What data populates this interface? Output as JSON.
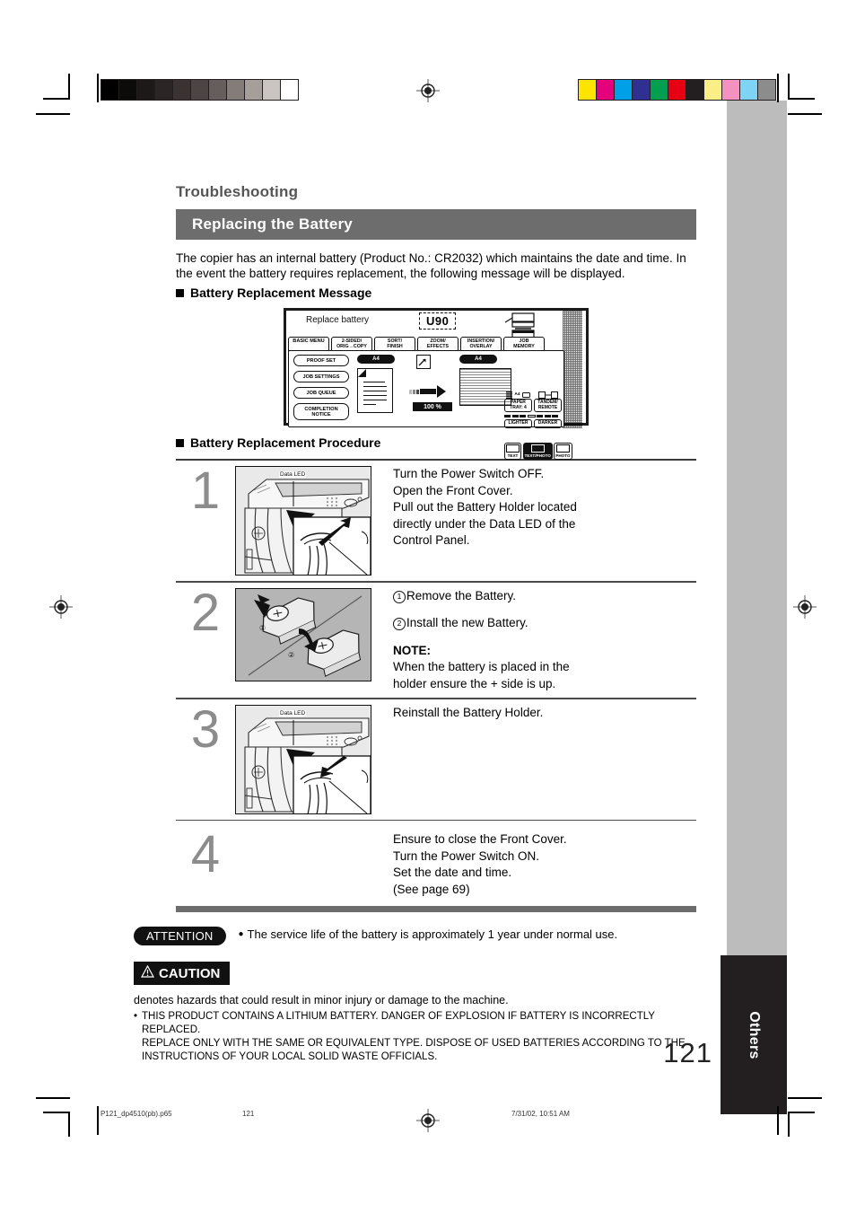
{
  "document": {
    "section_title": "Troubleshooting",
    "banner_title": "Replacing the Battery",
    "intro": "The copier has an internal battery (Product No.: CR2032) which maintains the date and time. In the event the battery requires replacement, the following message will be displayed.",
    "subheads": {
      "message": "Battery Replacement Message",
      "procedure": "Battery Replacement Procedure"
    },
    "page_number": "121",
    "side_tab": "Others"
  },
  "lcd": {
    "message": "Replace battery",
    "code": "U90",
    "tabs": [
      {
        "label": "BASIC MENU",
        "selected": true
      },
      {
        "label": "2-SIDED/\nORIG→COPY",
        "selected": false
      },
      {
        "label": "SORT/\nFINISH",
        "selected": false
      },
      {
        "label": "ZOOM/\nEFFECTS",
        "selected": false
      },
      {
        "label": "INSERTION/\nOVERLAY",
        "selected": false
      },
      {
        "label": "JOB\nMEMORY",
        "selected": false
      }
    ],
    "left_buttons": [
      "PROOF SET",
      "JOB SETTINGS",
      "JOB QUEUE",
      "COMPLETION\nNOTICE"
    ],
    "original_size": "A4",
    "output_size": "A4",
    "zoom_ratio": "100 %",
    "paper_tray": "PAPER TRAY: 4",
    "paper_tray_size": "A4",
    "tandem_remote": "TANDEM/\nREMOTE",
    "lighter": "LIGHTER",
    "darker": "DARKER",
    "modes": [
      {
        "label": "TEXT",
        "selected": false
      },
      {
        "label": "TEXT/PHOTO",
        "selected": true
      },
      {
        "label": "PHOTO",
        "selected": false
      }
    ]
  },
  "steps": [
    {
      "number": "1",
      "figure": "machine-front-cover-battery-holder",
      "figure_label": "Data LED",
      "lines": [
        "Turn the Power Switch OFF.",
        "Open the Front Cover.",
        "Pull out the Battery Holder located",
        "directly under the Data LED of the",
        "Control Panel."
      ]
    },
    {
      "number": "2",
      "figure": "battery-holder-remove-install",
      "figure_label": "",
      "callout_1": "1",
      "callout_2": "2",
      "item1": "Remove the Battery.",
      "item2": "Install the new Battery.",
      "note_label": "NOTE",
      "note_lines": [
        "When the battery is placed in the",
        "holder ensure the + side is up."
      ]
    },
    {
      "number": "3",
      "figure": "machine-reinstall-battery-holder",
      "figure_label": "Data LED",
      "lines": [
        "Reinstall the Battery Holder."
      ]
    },
    {
      "number": "4",
      "figure": "",
      "figure_label": "",
      "lines": [
        "Ensure to close the Front Cover.",
        "Turn the Power Switch ON.",
        "Set the date and time.",
        "(See page 69)"
      ]
    }
  ],
  "attention": {
    "badge": "ATTENTION",
    "text": "The service life of the battery is approximately 1 year under normal use."
  },
  "caution": {
    "badge": "CAUTION",
    "definition": "denotes hazards that could result in minor injury or damage to the machine.",
    "warning": "THIS PRODUCT CONTAINS A LITHIUM BATTERY. DANGER OF EXPLOSION IF BATTERY IS INCORRECTLY REPLACED.\nREPLACE ONLY WITH THE SAME OR EQUIVALENT TYPE. DISPOSE OF USED BATTERIES ACCORDING TO THE INSTRUCTIONS OF YOUR LOCAL SOLID WASTE OFFICIALS."
  },
  "footer": {
    "filename": "P121_dp4510(pb).p65",
    "page": "121",
    "timestamp": "7/31/02, 10:51 AM"
  },
  "calibration": {
    "grayscale": [
      "#000000",
      "#0d0a0a",
      "#1d1919",
      "#2b2625",
      "#3a3331",
      "#4d4544",
      "#665e5c",
      "#847c79",
      "#a69e9a",
      "#cbc5c1",
      "#ffffff"
    ],
    "color": [
      "#ffe400",
      "#e5007e",
      "#00a0e9",
      "#2e3192",
      "#00a050",
      "#e60012",
      "#231f20",
      "#fcee87",
      "#f491c0",
      "#7fd4f5",
      "#8c8c8c"
    ]
  }
}
